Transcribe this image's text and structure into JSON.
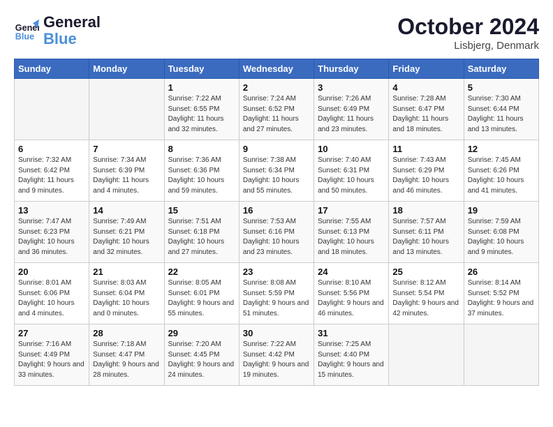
{
  "header": {
    "logo_line1": "General",
    "logo_line2": "Blue",
    "month": "October 2024",
    "location": "Lisbjerg, Denmark"
  },
  "weekdays": [
    "Sunday",
    "Monday",
    "Tuesday",
    "Wednesday",
    "Thursday",
    "Friday",
    "Saturday"
  ],
  "weeks": [
    [
      {
        "day": "",
        "info": ""
      },
      {
        "day": "",
        "info": ""
      },
      {
        "day": "1",
        "info": "Sunrise: 7:22 AM\nSunset: 6:55 PM\nDaylight: 11 hours and 32 minutes."
      },
      {
        "day": "2",
        "info": "Sunrise: 7:24 AM\nSunset: 6:52 PM\nDaylight: 11 hours and 27 minutes."
      },
      {
        "day": "3",
        "info": "Sunrise: 7:26 AM\nSunset: 6:49 PM\nDaylight: 11 hours and 23 minutes."
      },
      {
        "day": "4",
        "info": "Sunrise: 7:28 AM\nSunset: 6:47 PM\nDaylight: 11 hours and 18 minutes."
      },
      {
        "day": "5",
        "info": "Sunrise: 7:30 AM\nSunset: 6:44 PM\nDaylight: 11 hours and 13 minutes."
      }
    ],
    [
      {
        "day": "6",
        "info": "Sunrise: 7:32 AM\nSunset: 6:42 PM\nDaylight: 11 hours and 9 minutes."
      },
      {
        "day": "7",
        "info": "Sunrise: 7:34 AM\nSunset: 6:39 PM\nDaylight: 11 hours and 4 minutes."
      },
      {
        "day": "8",
        "info": "Sunrise: 7:36 AM\nSunset: 6:36 PM\nDaylight: 10 hours and 59 minutes."
      },
      {
        "day": "9",
        "info": "Sunrise: 7:38 AM\nSunset: 6:34 PM\nDaylight: 10 hours and 55 minutes."
      },
      {
        "day": "10",
        "info": "Sunrise: 7:40 AM\nSunset: 6:31 PM\nDaylight: 10 hours and 50 minutes."
      },
      {
        "day": "11",
        "info": "Sunrise: 7:43 AM\nSunset: 6:29 PM\nDaylight: 10 hours and 46 minutes."
      },
      {
        "day": "12",
        "info": "Sunrise: 7:45 AM\nSunset: 6:26 PM\nDaylight: 10 hours and 41 minutes."
      }
    ],
    [
      {
        "day": "13",
        "info": "Sunrise: 7:47 AM\nSunset: 6:23 PM\nDaylight: 10 hours and 36 minutes."
      },
      {
        "day": "14",
        "info": "Sunrise: 7:49 AM\nSunset: 6:21 PM\nDaylight: 10 hours and 32 minutes."
      },
      {
        "day": "15",
        "info": "Sunrise: 7:51 AM\nSunset: 6:18 PM\nDaylight: 10 hours and 27 minutes."
      },
      {
        "day": "16",
        "info": "Sunrise: 7:53 AM\nSunset: 6:16 PM\nDaylight: 10 hours and 23 minutes."
      },
      {
        "day": "17",
        "info": "Sunrise: 7:55 AM\nSunset: 6:13 PM\nDaylight: 10 hours and 18 minutes."
      },
      {
        "day": "18",
        "info": "Sunrise: 7:57 AM\nSunset: 6:11 PM\nDaylight: 10 hours and 13 minutes."
      },
      {
        "day": "19",
        "info": "Sunrise: 7:59 AM\nSunset: 6:08 PM\nDaylight: 10 hours and 9 minutes."
      }
    ],
    [
      {
        "day": "20",
        "info": "Sunrise: 8:01 AM\nSunset: 6:06 PM\nDaylight: 10 hours and 4 minutes."
      },
      {
        "day": "21",
        "info": "Sunrise: 8:03 AM\nSunset: 6:04 PM\nDaylight: 10 hours and 0 minutes."
      },
      {
        "day": "22",
        "info": "Sunrise: 8:05 AM\nSunset: 6:01 PM\nDaylight: 9 hours and 55 minutes."
      },
      {
        "day": "23",
        "info": "Sunrise: 8:08 AM\nSunset: 5:59 PM\nDaylight: 9 hours and 51 minutes."
      },
      {
        "day": "24",
        "info": "Sunrise: 8:10 AM\nSunset: 5:56 PM\nDaylight: 9 hours and 46 minutes."
      },
      {
        "day": "25",
        "info": "Sunrise: 8:12 AM\nSunset: 5:54 PM\nDaylight: 9 hours and 42 minutes."
      },
      {
        "day": "26",
        "info": "Sunrise: 8:14 AM\nSunset: 5:52 PM\nDaylight: 9 hours and 37 minutes."
      }
    ],
    [
      {
        "day": "27",
        "info": "Sunrise: 7:16 AM\nSunset: 4:49 PM\nDaylight: 9 hours and 33 minutes."
      },
      {
        "day": "28",
        "info": "Sunrise: 7:18 AM\nSunset: 4:47 PM\nDaylight: 9 hours and 28 minutes."
      },
      {
        "day": "29",
        "info": "Sunrise: 7:20 AM\nSunset: 4:45 PM\nDaylight: 9 hours and 24 minutes."
      },
      {
        "day": "30",
        "info": "Sunrise: 7:22 AM\nSunset: 4:42 PM\nDaylight: 9 hours and 19 minutes."
      },
      {
        "day": "31",
        "info": "Sunrise: 7:25 AM\nSunset: 4:40 PM\nDaylight: 9 hours and 15 minutes."
      },
      {
        "day": "",
        "info": ""
      },
      {
        "day": "",
        "info": ""
      }
    ]
  ]
}
